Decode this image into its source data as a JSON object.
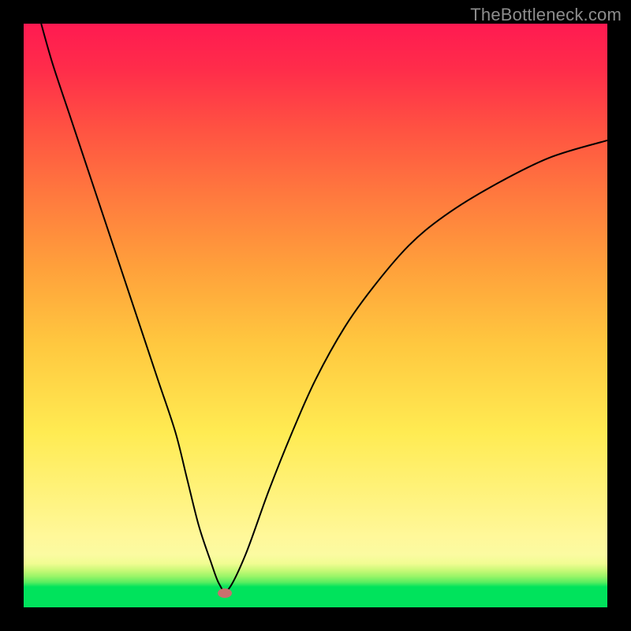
{
  "watermark": "TheBottleneck.com",
  "chart_data": {
    "type": "line",
    "title": "",
    "xlabel": "",
    "ylabel": "",
    "xlim": [
      0,
      100
    ],
    "ylim": [
      0,
      100
    ],
    "series": [
      {
        "name": "bottleneck-curve",
        "x": [
          3,
          5,
          8,
          11,
          14,
          17,
          20,
          23,
          26,
          28,
          30,
          32,
          33.5,
          35,
          38,
          42,
          46,
          50,
          55,
          60,
          66,
          72,
          80,
          90,
          100
        ],
        "values": [
          100,
          93,
          84,
          75,
          66,
          57,
          48,
          39,
          30,
          22,
          14,
          8,
          4,
          3,
          9,
          20,
          30,
          39,
          48,
          55,
          62,
          67,
          72,
          77,
          80
        ]
      }
    ],
    "marker": {
      "x": 34.5,
      "y": 2.4,
      "color": "#c9706e"
    },
    "gradient_colors": {
      "top": "#ff1a51",
      "mid": "#ffeb52",
      "bottom": "#00e35c"
    }
  }
}
